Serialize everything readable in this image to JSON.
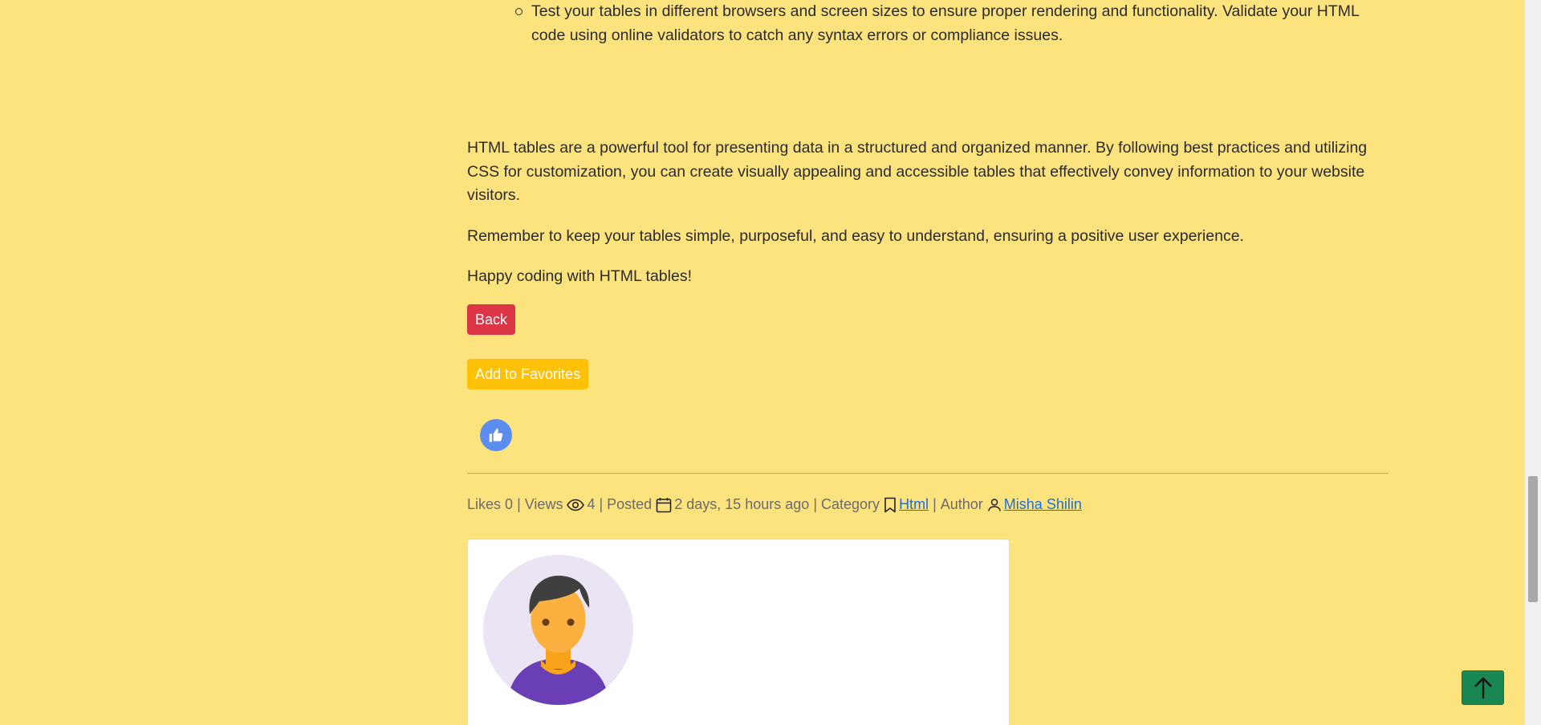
{
  "content": {
    "tips": [
      "Test your tables in different browsers and screen sizes to ensure proper rendering and functionality. Validate your HTML code using online validators to catch any syntax errors or compliance issues."
    ],
    "paragraphs": {
      "summary": "HTML tables are a powerful tool for presenting data in a structured and organized manner. By following best practices and utilizing CSS for customization, you can create visually appealing and accessible tables that effectively convey information to your website visitors.",
      "remember": "Remember to keep your tables simple, purposeful, and easy to understand, ensuring a positive user experience.",
      "closing": "Happy coding with HTML tables!"
    }
  },
  "actions": {
    "back_label": "Back",
    "favorites_label": "Add to Favorites",
    "like_icon": "thumbs-up-icon"
  },
  "meta": {
    "likes_label": "Likes",
    "likes_count": "0",
    "views_label": "Views",
    "views_count": "4",
    "posted_label": "Posted",
    "posted_value": "2 days, 15 hours ago",
    "category_label": "Category",
    "category_value": "Html",
    "author_label": "Author",
    "author_value": "Misha Shilin",
    "separator": "|"
  },
  "colors": {
    "page_background": "#fce37e",
    "back_button": "#dc3545",
    "favorites_button": "#ffc107",
    "like_button": "#5b8def",
    "back_to_top": "#198754",
    "link": "#1a6fe0"
  },
  "icons": {
    "views": "eye-icon",
    "posted": "calendar-icon",
    "category": "bookmark-icon",
    "author": "person-icon",
    "back_to_top": "arrow-up-icon",
    "avatar": "user-avatar-illustration"
  }
}
